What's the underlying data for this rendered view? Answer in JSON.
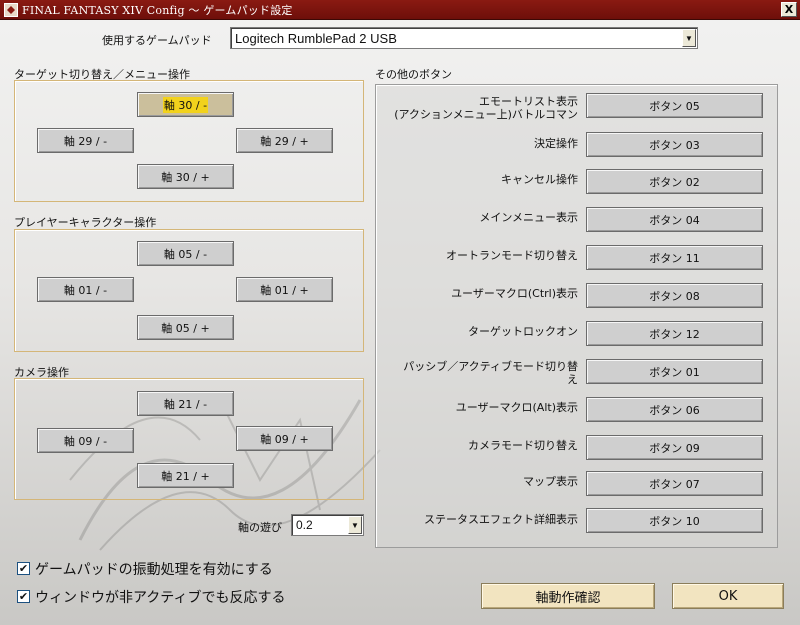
{
  "window": {
    "title": "FINAL FANTASY XIV Config ～ ゲームパッド設定",
    "close_label": "X"
  },
  "gamepad": {
    "label": "使用するゲームパッド",
    "selected": "Logitech RumblePad 2 USB"
  },
  "target_group": {
    "title": "ターゲット切り替え／メニュー操作",
    "up": "軸 30 / -",
    "left": "軸 29 / -",
    "right": "軸 29 / +",
    "down": "軸 30 / +"
  },
  "player_group": {
    "title": "プレイヤーキャラクター操作",
    "up": "軸 05 / -",
    "left": "軸 01 / -",
    "right": "軸 01 / +",
    "down": "軸 05 / +"
  },
  "camera_group": {
    "title": "カメラ操作",
    "up": "軸 21 / -",
    "left": "軸 09 / -",
    "right": "軸 09 / +",
    "down": "軸 21 / +"
  },
  "deadzone": {
    "label": "軸の遊び",
    "selected": "0.2"
  },
  "other_buttons": {
    "title": "その他のボタン",
    "rows": [
      {
        "label": "エモートリスト表示\n(アクションメニュー上)バトルコマン",
        "value": "ボタン 05"
      },
      {
        "label": "決定操作",
        "value": "ボタン 03"
      },
      {
        "label": "キャンセル操作",
        "value": "ボタン 02"
      },
      {
        "label": "メインメニュー表示",
        "value": "ボタン 04"
      },
      {
        "label": "オートランモード切り替え",
        "value": "ボタン 11"
      },
      {
        "label": "ユーザーマクロ(Ctrl)表示",
        "value": "ボタン 08"
      },
      {
        "label": "ターゲットロックオン",
        "value": "ボタン 12"
      },
      {
        "label": "パッシブ／アクティブモード切り替\nえ",
        "value": "ボタン 01"
      },
      {
        "label": "ユーザーマクロ(Alt)表示",
        "value": "ボタン 06"
      },
      {
        "label": "カメラモード切り替え",
        "value": "ボタン 09"
      },
      {
        "label": "マップ表示",
        "value": "ボタン 07"
      },
      {
        "label": "ステータスエフェクト詳細表示",
        "value": "ボタン 10"
      }
    ]
  },
  "options": {
    "vibration_label": "ゲームパッドの振動処理を有効にする",
    "vibration_checked": true,
    "inactive_label": "ウィンドウが非アクティブでも反応する",
    "inactive_checked": true
  },
  "actions": {
    "test_label": "軸動作確認",
    "ok_label": "OK"
  },
  "colors": {
    "titlebar": "#7a130d",
    "group_border": "#d4b678",
    "highlight": "#f2d21c"
  }
}
